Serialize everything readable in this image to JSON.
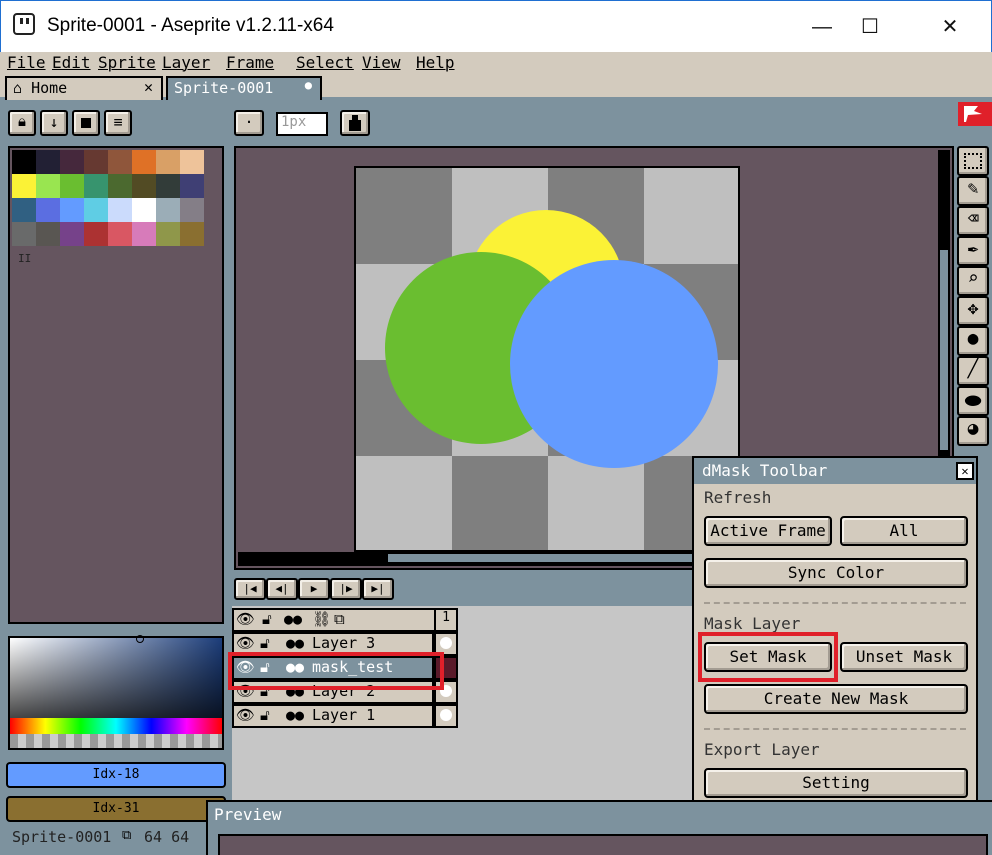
{
  "window": {
    "title": "Sprite-0001 - Aseprite v1.2.11-x64",
    "minimize": "—",
    "maximize": "☐",
    "close": "✕"
  },
  "menu": {
    "items": [
      "File",
      "Edit",
      "Sprite",
      "Layer",
      "Frame",
      "Select",
      "View",
      "Help"
    ]
  },
  "tabs": [
    {
      "label": "Home",
      "close": "✕",
      "icon": "home-icon"
    },
    {
      "label": "Sprite-0001",
      "dot": "●"
    }
  ],
  "context_bar": {
    "brush_size_placeholder": "1px",
    "dot_label": "·"
  },
  "palette": {
    "colors": [
      "#000000",
      "#222034",
      "#45283c",
      "#663931",
      "#8f563b",
      "#df7126",
      "#d9a066",
      "#eec39a",
      "#fbf236",
      "#99e550",
      "#6abe30",
      "#37946e",
      "#4b692f",
      "#524b24",
      "#323c39",
      "#3f3f74",
      "#306082",
      "#5b6ee1",
      "#639bff",
      "#5fcde4",
      "#cbdbfc",
      "#ffffff",
      "#9badb7",
      "#847e87",
      "#696a6a",
      "#595652",
      "#76428a",
      "#ac3232",
      "#d95763",
      "#d77bba",
      "#8f974a",
      "#8a6f30"
    ],
    "pause_label": "II"
  },
  "color_bars": {
    "fg": {
      "label": "Idx-18",
      "color": "#639bff"
    },
    "bg": {
      "label": "Idx-31",
      "color": "#8a6f30"
    }
  },
  "status": {
    "sprite_name": "Sprite-0001",
    "size": "64 64"
  },
  "timeline": {
    "frame_number": "1",
    "layers": [
      {
        "name": "Layer 3"
      },
      {
        "name": "mask_test"
      },
      {
        "name": "Layer 2"
      },
      {
        "name": "Layer 1"
      }
    ]
  },
  "dmask": {
    "title": "dMask Toolbar",
    "close": "✕",
    "refresh_label": "Refresh",
    "active_frame_button": "Active Frame",
    "all_button": "All",
    "sync_color_button": "Sync Color",
    "mask_layer_label": "Mask Layer",
    "set_mask_button": "Set Mask",
    "unset_mask_button": "Unset Mask",
    "create_new_mask_button": "Create New Mask",
    "export_layer_label": "Export Layer",
    "setting_button": "Setting"
  },
  "preview": {
    "title": "Preview"
  },
  "colors": {
    "accent_highlight": "#e0202a",
    "panel": "#d3cbbe",
    "bg": "#7d929e",
    "canvas_bg": "#65555f"
  }
}
